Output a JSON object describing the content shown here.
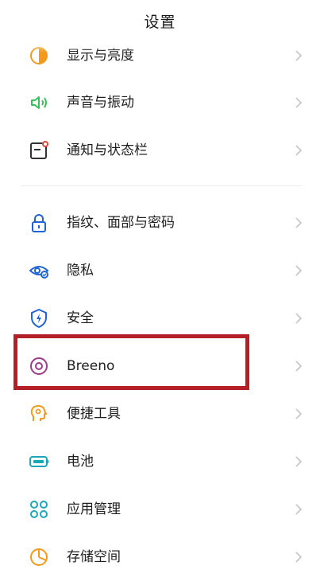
{
  "header": {
    "title": "设置"
  },
  "groups": [
    {
      "items": [
        {
          "label": "显示与亮度",
          "icon": "brightness-icon"
        },
        {
          "label": "声音与振动",
          "icon": "speaker-icon"
        },
        {
          "label": "通知与状态栏",
          "icon": "notification-icon"
        }
      ]
    },
    {
      "items": [
        {
          "label": "指纹、面部与密码",
          "icon": "lock-icon"
        },
        {
          "label": "隐私",
          "icon": "privacy-eye-icon"
        },
        {
          "label": "安全",
          "icon": "shield-icon"
        },
        {
          "label": "Breeno",
          "icon": "breeno-icon",
          "highlighted": true
        },
        {
          "label": "便捷工具",
          "icon": "tools-icon"
        },
        {
          "label": "电池",
          "icon": "battery-icon"
        },
        {
          "label": "应用管理",
          "icon": "apps-icon"
        },
        {
          "label": "存储空间",
          "icon": "storage-icon"
        }
      ]
    }
  ],
  "colors": {
    "highlight_border": "#b32025",
    "icon_orange": "#f39a1e",
    "icon_green": "#3cbf5a",
    "icon_blue": "#1f63d6",
    "icon_purple": "#9c3b8e",
    "icon_teal": "#1ca6b8"
  }
}
